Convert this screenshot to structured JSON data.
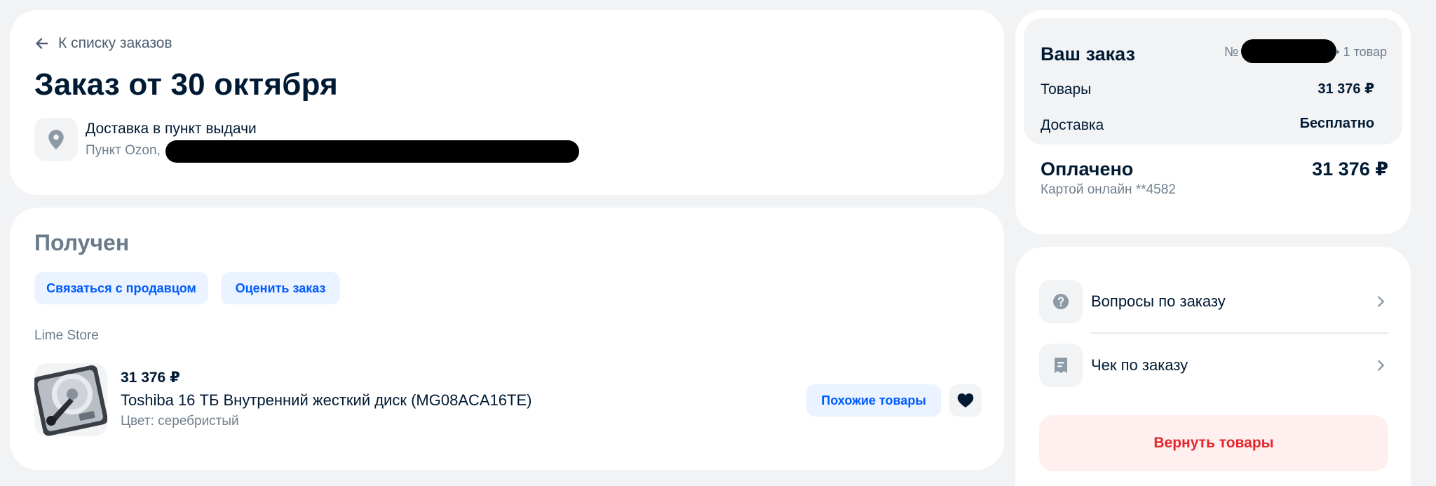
{
  "header": {
    "back_label": "К списку заказов",
    "title": "Заказ от 30 октября",
    "delivery_title": "Доставка в пункт выдачи",
    "delivery_address_prefix": "Пункт Ozon,"
  },
  "order": {
    "status": "Получен",
    "contact_seller_label": "Связаться с продавцом",
    "rate_order_label": "Оценить заказ",
    "store_name": "Lime Store",
    "item": {
      "price": "31 376 ₽",
      "name": "Toshiba 16 ТБ Внутренний жесткий диск (MG08ACA16TE)",
      "color": "Цвет: серебристый",
      "similar_label": "Похожие товары"
    }
  },
  "summary": {
    "title": "Ваш заказ",
    "number_label": "№",
    "count": "• 1 товар",
    "rows": [
      {
        "label": "Товары",
        "value": "31 376 ₽"
      },
      {
        "label": "Доставка",
        "value": "Бесплатно"
      }
    ],
    "paid_label": "Оплачено",
    "paid_total": "31 376 ₽",
    "payment_method": "Картой онлайн **4582"
  },
  "actions": {
    "items": [
      {
        "label": "Вопросы по заказу",
        "icon": "question-icon"
      },
      {
        "label": "Чек по заказу",
        "icon": "receipt-icon"
      }
    ],
    "return_label": "Вернуть товары"
  },
  "colors": {
    "accent": "#005bff",
    "accent_bg": "#eaf3ff",
    "danger": "#e3272e",
    "danger_bg": "#fff0ef",
    "text": "#001a34",
    "muted": "#707f8d",
    "page_bg": "#f2f3f5"
  }
}
